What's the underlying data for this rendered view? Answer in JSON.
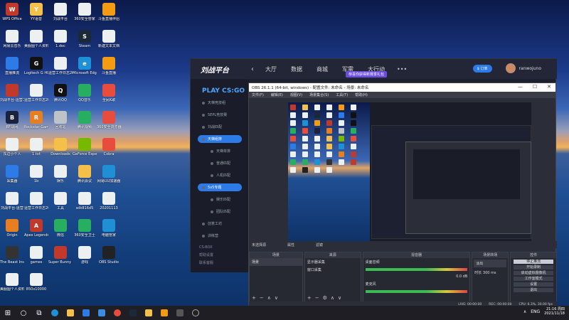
{
  "desktop": {
    "icons": [
      {
        "label": "WPS Office",
        "color": "#c0392b",
        "glyph": "W"
      },
      {
        "label": "YY语音",
        "color": "#f5c04a",
        "glyph": "Y"
      },
      {
        "label": "刘战平台",
        "color": "#ecf0f1",
        "glyph": ""
      },
      {
        "label": "360安全管家",
        "color": "#ecf0f1",
        "glyph": ""
      },
      {
        "label": "斗鱼直播伴侣",
        "color": "#f39c12",
        "glyph": ""
      },
      {
        "label": "网易云音乐",
        "color": "#ecf0f1",
        "glyph": ""
      },
      {
        "label": "美服图个人资料1",
        "color": "#ecf0f1",
        "glyph": ""
      },
      {
        "label": "1.doc",
        "color": "#ecf0f1",
        "glyph": ""
      },
      {
        "label": "Steam",
        "color": "#1b2838",
        "glyph": "S"
      },
      {
        "label": "新建文本文档",
        "color": "#ecf0f1",
        "glyph": ""
      },
      {
        "label": "直播推流",
        "color": "#2d7be6",
        "glyph": ""
      },
      {
        "label": "Logitech G HUB",
        "color": "#111",
        "glyph": "G"
      },
      {
        "label": "运营工作日志20210504",
        "color": "#ecf0f1",
        "glyph": ""
      },
      {
        "label": "Microsoft Edge",
        "color": "#1f8fd6",
        "glyph": "e"
      },
      {
        "label": "斗鱼直播",
        "color": "#f39c12",
        "glyph": ""
      },
      {
        "label": "刘战平台-运营工作日志",
        "color": "#c0392b",
        "glyph": ""
      },
      {
        "label": "运营工作日志20210429",
        "color": "#ecf0f1",
        "glyph": ""
      },
      {
        "label": "腾讯QQ",
        "color": "#111",
        "glyph": "Q"
      },
      {
        "label": "QQ音乐",
        "color": "#27ae60",
        "glyph": ""
      },
      {
        "label": "全民K歌",
        "color": "#e74c3c",
        "glyph": ""
      },
      {
        "label": "BF战网",
        "color": "#1a2240",
        "glyph": "B"
      },
      {
        "label": "Rockstar Games",
        "color": "#e67e22",
        "glyph": "R"
      },
      {
        "label": "回收站",
        "color": "#bdc3c7",
        "glyph": ""
      },
      {
        "label": "腾讯视频",
        "color": "#27ae60",
        "glyph": ""
      },
      {
        "label": "360安全浏览器",
        "color": "#e74c3c",
        "glyph": ""
      },
      {
        "label": "东边小个人",
        "color": "#ecf0f1",
        "glyph": ""
      },
      {
        "label": "1.txt",
        "color": "#ecf0f1",
        "glyph": ""
      },
      {
        "label": "Downloads",
        "color": "#f5c04a",
        "glyph": ""
      },
      {
        "label": "GeForce Experience",
        "color": "#76b900",
        "glyph": ""
      },
      {
        "label": "Cobra",
        "color": "#e74c3c",
        "glyph": ""
      },
      {
        "label": "采集器",
        "color": "#2d7be6",
        "glyph": ""
      },
      {
        "label": "1b",
        "color": "#ecf0f1",
        "glyph": ""
      },
      {
        "label": "娱乐",
        "color": "#ecf0f1",
        "glyph": ""
      },
      {
        "label": "腾讯会议",
        "color": "#f5c04a",
        "glyph": ""
      },
      {
        "label": "网易UU加速器",
        "color": "#1f8fd6",
        "glyph": ""
      },
      {
        "label": "刘战平台-运营",
        "color": "#ecf0f1",
        "glyph": ""
      },
      {
        "label": "运营工作日志20210503",
        "color": "#ecf0f1",
        "glyph": ""
      },
      {
        "label": "工具",
        "color": "#ecf0f1",
        "glyph": ""
      },
      {
        "label": "sdk816d5",
        "color": "#ecf0f1",
        "glyph": ""
      },
      {
        "label": "20201113",
        "color": "#ecf0f1",
        "glyph": ""
      },
      {
        "label": "Origin",
        "color": "#e67e22",
        "glyph": ""
      },
      {
        "label": "Apex Legends",
        "color": "#c0392b",
        "glyph": "A"
      },
      {
        "label": "微信",
        "color": "#27ae60",
        "glyph": ""
      },
      {
        "label": "360安全卫士",
        "color": "#27ae60",
        "glyph": ""
      },
      {
        "label": "电脑管家",
        "color": "#1f8fd6",
        "glyph": ""
      },
      {
        "label": "The Beast Inside",
        "color": "#333",
        "glyph": ""
      },
      {
        "label": "games",
        "color": "#ecf0f1",
        "glyph": ""
      },
      {
        "label": "Super Bunny Man",
        "color": "#c0392b",
        "glyph": ""
      },
      {
        "label": "游戏",
        "color": "#ecf0f1",
        "glyph": ""
      },
      {
        "label": "OBS Studio",
        "color": "#222",
        "glyph": ""
      },
      {
        "label": "美服图个人资料",
        "color": "#ecf0f1",
        "glyph": ""
      },
      {
        "label": "850x10000",
        "color": "#ecf0f1",
        "glyph": ""
      }
    ]
  },
  "platform": {
    "logo": "刘战平台",
    "nav": [
      "大厅",
      "数据",
      "商城",
      "军需",
      "大行动"
    ],
    "badge": "恭喜你获得新赛季礼包",
    "more": "•••",
    "cash": "$ 订单",
    "username": "ranwojuno",
    "brand": "PLAY CS:GO",
    "menu": [
      {
        "label": "天梯竞技组",
        "active": false,
        "sub": false
      },
      {
        "label": "5EPL竞技赛",
        "active": false,
        "sub": false
      },
      {
        "label": "刘战匹配",
        "active": false,
        "sub": false
      },
      {
        "label": "天梯组排",
        "active": true,
        "sub": false
      },
      {
        "label": "天梯单排",
        "active": false,
        "sub": true
      },
      {
        "label": "普通匹配",
        "active": false,
        "sub": true
      },
      {
        "label": "人机匹配",
        "active": false,
        "sub": true
      },
      {
        "label": "5v5专题",
        "active": true,
        "sub": false
      },
      {
        "label": "娱乐匹配",
        "active": false,
        "sub": true
      },
      {
        "label": "团队匹配",
        "active": false,
        "sub": true
      },
      {
        "label": "创意工坊",
        "active": false,
        "sub": false
      },
      {
        "label": "训练营",
        "active": false,
        "sub": false
      }
    ],
    "footer": [
      "CS-BOX",
      "帮助设置",
      "联系客服"
    ]
  },
  "obs": {
    "title": "OBS 26.1.1 (64-bit, windows) - 配置文件: 未命名 - 场景: 未命名",
    "menu": [
      "文件(F)",
      "编辑(E)",
      "视图(V)",
      "场景集合(S)",
      "工具(T)",
      "帮助(H)"
    ],
    "controls": [
      "—",
      "☐",
      "✕"
    ],
    "source_bar": [
      "未选择源",
      "属性",
      "滤镜"
    ],
    "docks": {
      "scenes": {
        "title": "场景",
        "items": [
          "场景"
        ]
      },
      "sources": {
        "title": "来源",
        "items": [
          "显示器采集",
          "窗口采集"
        ]
      },
      "mixer": {
        "title": "混音器",
        "tracks": [
          {
            "name": "桌面音频",
            "db": "0.0 dB"
          },
          {
            "name": "麦克风",
            "db": "0.0 dB"
          }
        ]
      },
      "transitions": {
        "title": "场景转场",
        "type": "淡出",
        "duration_label": "时长",
        "duration": "300 ms"
      },
      "controls": {
        "title": "控件",
        "buttons": [
          "停止推流",
          "开始录制",
          "启动虚拟摄像机",
          "工作室模式",
          "设置",
          "退出"
        ]
      }
    },
    "status": [
      "LIVE: 00:00:00",
      "REC: 00:00:00",
      "CPU: 6.3%, 30.00 fps"
    ]
  },
  "taskbar": {
    "start": "⊞",
    "search": "○",
    "taskview": "⧉",
    "tray_lang": "ENG",
    "time": "21:16 周四",
    "date": "2021/11/18"
  }
}
